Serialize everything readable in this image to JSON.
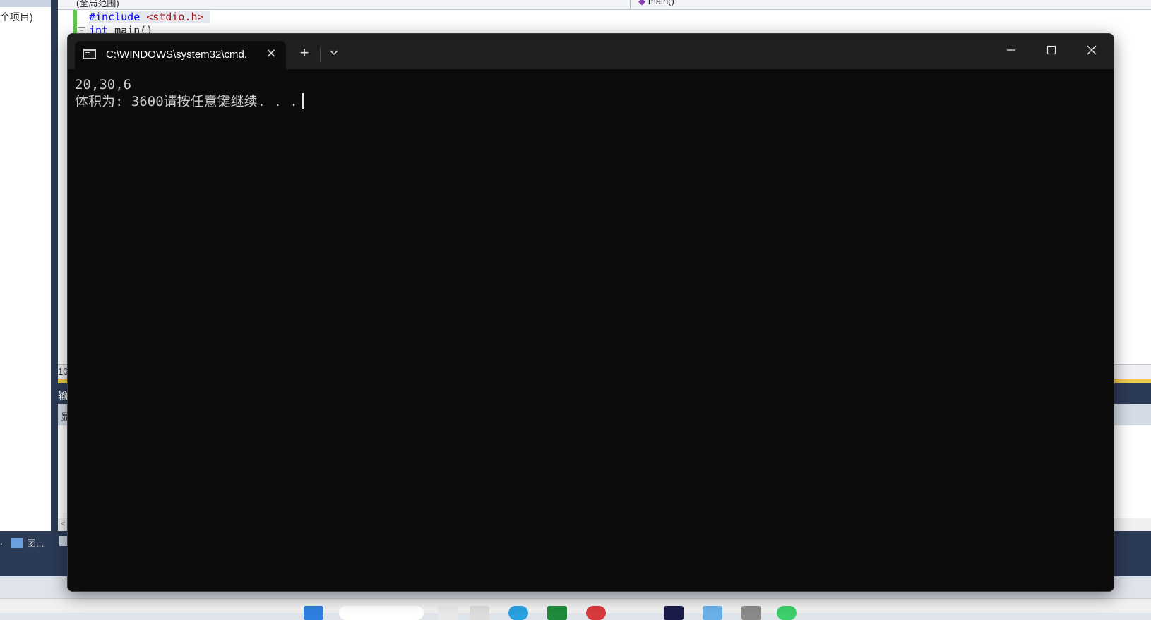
{
  "ide": {
    "left_panel_label": "个项目)",
    "scope_left": "(全局范围)",
    "scope_right": "main()",
    "code_lines": [
      "#include <stdio.h>",
      "int main()"
    ],
    "code_tokens": {
      "line1_kw": "#include",
      "line1_inc": " <stdio.h>",
      "line2_kw": "int",
      "line2_rest": " main()"
    },
    "status_text": "10",
    "output_title": "输",
    "output_toolbar_label": "显",
    "scroll_arrow": "<",
    "bottom_tabs": [
      {
        "label": "."
      },
      {
        "label": "团..."
      },
      {
        "label": ""
      }
    ]
  },
  "cmd": {
    "tab_title": "C:\\WINDOWS\\system32\\cmd.",
    "tab_close_glyph": "✕",
    "new_tab_glyph": "+",
    "output_lines": [
      "20,30,6",
      "体积为: 3600请按任意键继续. . ."
    ]
  },
  "colors": {
    "console_bg": "#0c0c0c",
    "titlebar_bg": "#202020",
    "console_text": "#cccccc",
    "ide_dark": "#2b3a55",
    "output_accent": "#f2c94c"
  }
}
